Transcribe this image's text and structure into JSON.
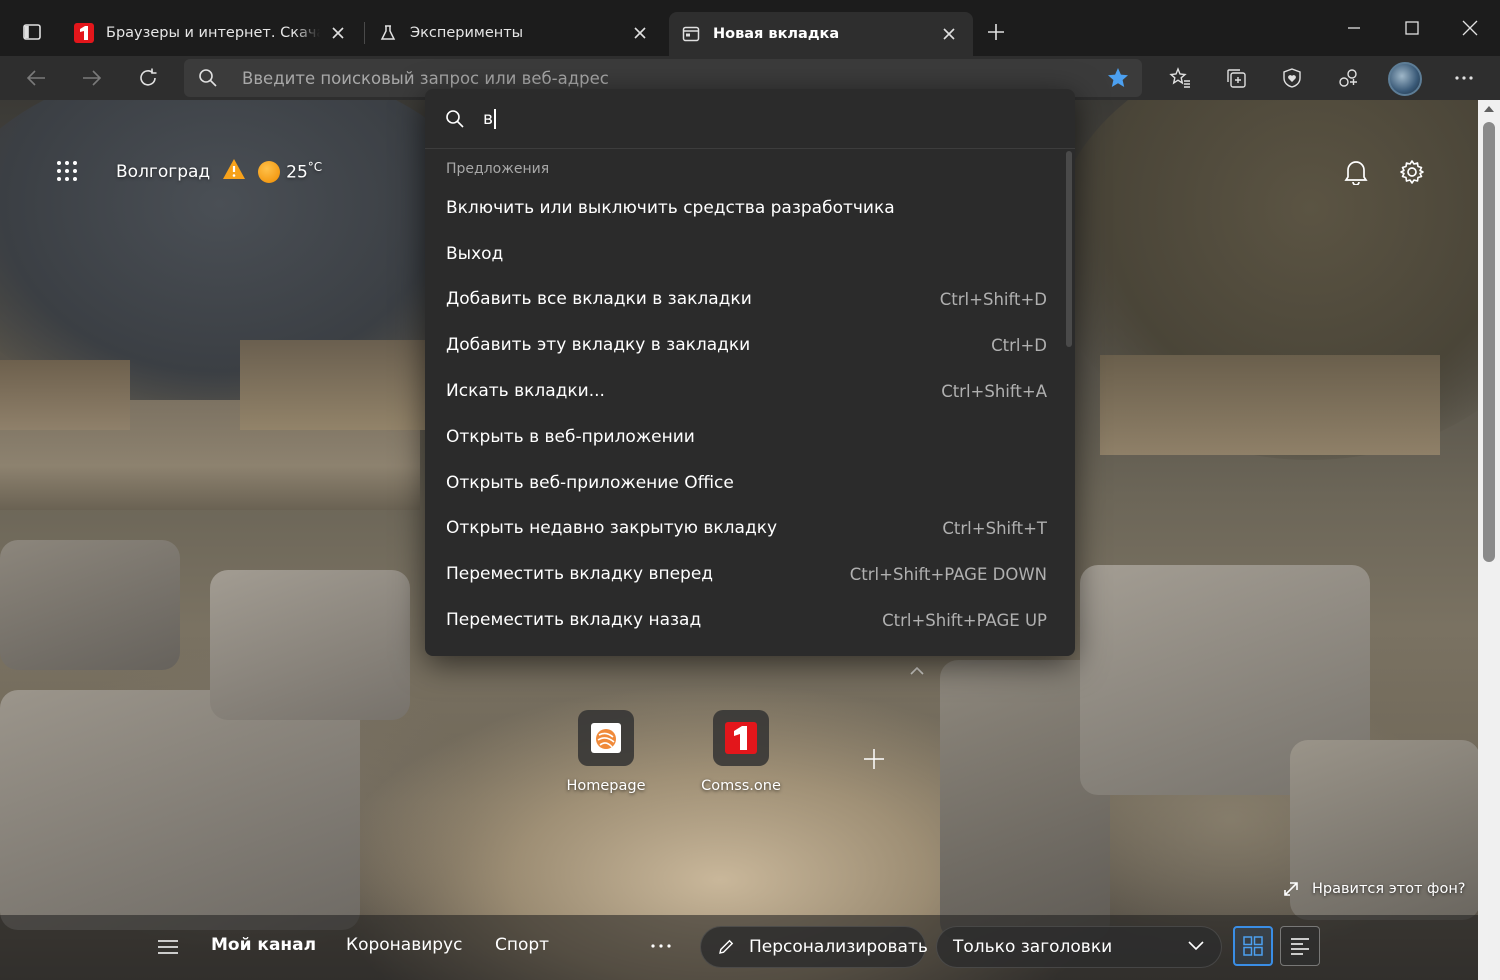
{
  "tabs": [
    {
      "title": "Браузеры и интернет. Скачать беспл",
      "favicon": "comss-logo-icon"
    },
    {
      "title": "Эксперименты",
      "favicon": "flask-icon"
    },
    {
      "title": "Новая вкладка",
      "favicon": "new-tab-page-icon"
    }
  ],
  "toolbar": {
    "address_placeholder": "Введите поисковый запрос или веб-адрес",
    "accent": "#3a8ee6"
  },
  "ntp": {
    "city": "Волгоград",
    "temperature": "25",
    "temp_unit": "°C",
    "quick_links": [
      {
        "label": "Homepage",
        "icon": "homepage-icon"
      },
      {
        "label": "Comss.one",
        "icon": "comss-logo-icon"
      }
    ],
    "like_background": "Нравится этот фон?"
  },
  "feed": {
    "tabs": [
      "Мой канал",
      "Коронавирус",
      "Спорт"
    ],
    "personalize": "Персонализировать",
    "view_select": "Только заголовки"
  },
  "palette": {
    "query": "в",
    "section_title": "Предложения",
    "items": [
      {
        "label": "Включить или выключить средства разработчика",
        "shortcut": ""
      },
      {
        "label": "Выход",
        "shortcut": ""
      },
      {
        "label": "Добавить все вкладки в закладки",
        "shortcut": "Ctrl+Shift+D"
      },
      {
        "label": "Добавить эту вкладку в закладки",
        "shortcut": "Ctrl+D"
      },
      {
        "label": "Искать вкладки...",
        "shortcut": "Ctrl+Shift+A"
      },
      {
        "label": "Открыть в веб-приложении",
        "shortcut": ""
      },
      {
        "label": "Открыть веб-приложение Office",
        "shortcut": ""
      },
      {
        "label": "Открыть недавно закрытую вкладку",
        "shortcut": "Ctrl+Shift+T"
      },
      {
        "label": "Переместить вкладку вперед",
        "shortcut": "Ctrl+Shift+PAGE DOWN"
      },
      {
        "label": "Переместить вкладку назад",
        "shortcut": "Ctrl+Shift+PAGE UP"
      }
    ]
  }
}
